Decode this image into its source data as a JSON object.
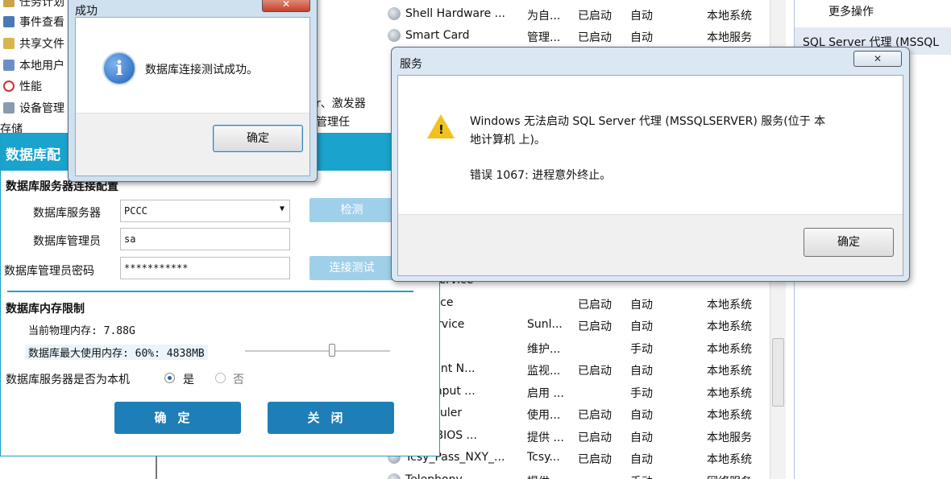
{
  "tree": {
    "items": [
      "任务计划",
      "事件查看",
      "共享文件",
      "本地用户",
      "性能",
      "设备管理",
      "存储"
    ]
  },
  "middle": {
    "desc_fragment_1": "r、激发器",
    "desc_fragment_2": "管理任"
  },
  "services": {
    "rows": [
      {
        "name": "Shell Hardware ...",
        "desc": "为自...",
        "status": "已启动",
        "startup": "自动",
        "logon": "本地系统"
      },
      {
        "name": "Smart Card",
        "desc": "管理...",
        "status": "已启动",
        "startup": "自动",
        "logon": "本地服务"
      },
      {
        "name": "nitorService",
        "desc": "",
        "status": "",
        "startup": "",
        "logon": ""
      },
      {
        "name": "cService",
        "desc": "",
        "status": "已启动",
        "startup": "自动",
        "logon": "本地系统"
      },
      {
        "name": "ginService",
        "desc": "Sunl...",
        "status": "已启动",
        "startup": "自动",
        "logon": "本地系统"
      },
      {
        "name": "fetch",
        "desc": "维护...",
        "status": "",
        "startup": "手动",
        "logon": "本地系统"
      },
      {
        "name": "m Event N...",
        "desc": "监视...",
        "status": "已启动",
        "startup": "自动",
        "logon": "本地系统"
      },
      {
        "name": "t PC Input ...",
        "desc": "启用 ...",
        "status": "",
        "startup": "手动",
        "logon": "本地系统"
      },
      {
        "name": "Scheduler",
        "desc": "使用...",
        "status": "已启动",
        "startup": "自动",
        "logon": "本地系统"
      },
      {
        "name": "P NetBIOS ...",
        "desc": "提供 ...",
        "status": "已启动",
        "startup": "自动",
        "logon": "本地服务"
      },
      {
        "name": "Tcsy_Pass_NXY_...",
        "desc": "Tcsy...",
        "status": "已启动",
        "startup": "自动",
        "logon": "本地系统"
      },
      {
        "name": "Telephony",
        "desc": "提供...",
        "status": "",
        "startup": "手动",
        "logon": "网络服务"
      }
    ]
  },
  "actions": {
    "more_actions": "更多操作",
    "selected_service": "SQL Server 代理 (MSSQL"
  },
  "db_window": {
    "title": "数据库配",
    "section_connection": "数据库服务器连接配置",
    "server_label": "数据库服务器",
    "server_value": "PCCC",
    "detect_button": "检测",
    "admin_label": "数据库管理员",
    "admin_value": "sa",
    "password_label": "数据库管理员密码",
    "password_value": "***********",
    "test_button": "连接测试",
    "section_memory": "数据库内存限制",
    "physical_memory": "当前物理内存: 7.88G",
    "max_memory": "数据库最大使用内存: 60%: 4838MB",
    "memory_fraction": 0.6,
    "is_local_label": "数据库服务器是否为本机",
    "radio_yes": "是",
    "radio_no": "否",
    "ok_button": "确定",
    "close_button": "关闭"
  },
  "success_dialog": {
    "title": "成功",
    "message": "数据库连接测试成功。",
    "ok_button": "确定",
    "close_glyph": "✕"
  },
  "error_dialog": {
    "title": "服务",
    "message_line1": "Windows 无法启动 SQL Server 代理 (MSSQLSERVER) 服务(位于 本",
    "message_line2": "地计算机 上)。",
    "error_line": "错误 1067: 进程意外终止。",
    "ok_button": "确定",
    "close_glyph": "✕"
  }
}
